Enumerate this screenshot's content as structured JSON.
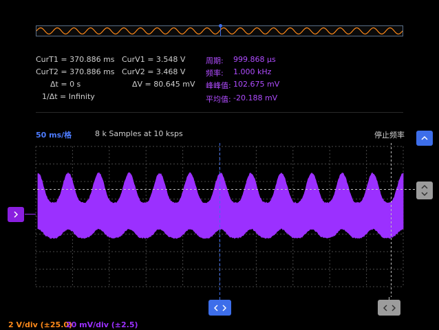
{
  "measurements": {
    "cur_t1": {
      "label": "CurT1 =",
      "value": "370.886 ms"
    },
    "cur_t2": {
      "label": "CurT2 =",
      "value": "370.886 ms"
    },
    "delta_t": {
      "label": "Δt =",
      "value": "0 s"
    },
    "inv_delta_t": {
      "label": "1/Δt =",
      "value": "Infinity"
    },
    "cur_v1": {
      "label": "CurV1 =",
      "value": "3.548 V"
    },
    "cur_v2": {
      "label": "CurV2 =",
      "value": "3.468 V"
    },
    "delta_v": {
      "label": "ΔV =",
      "value": "80.645 mV"
    },
    "period": {
      "label": "周期:",
      "value": "999.868 μs"
    },
    "frequency": {
      "label": "频率:",
      "value": "1.000 kHz"
    },
    "peak_to_peak": {
      "label": "峰峰值:",
      "value": "102.675 mV"
    },
    "average": {
      "label": "平均值:",
      "value": "-20.188 mV"
    }
  },
  "toolbar": {
    "timebase": "50 ms/格",
    "samples": "8 k Samples at 10 ksps",
    "status": "停止频率"
  },
  "footer": {
    "ch1_scale": "2 V/div (±25.0)",
    "ch2_scale": "20 mV/div (±2.5)"
  },
  "icons": {
    "scroll_up": "chevron-up-icon",
    "ch2_marker": "chevron-right-icon",
    "trigger_level": "chevron-up-down-icon",
    "horizontal_position": "chevron-left-right-icon",
    "cursor_handle": "chevron-left-right-icon"
  },
  "colors": {
    "background": "#000000",
    "ch1": "#ff8a1a",
    "ch2": "#9b30ff",
    "accent_blue": "#3d6eea",
    "cursor": "#3d6eea"
  },
  "scope_traces": {
    "ch2_peak_count": 12,
    "overview_cycles": 22
  }
}
